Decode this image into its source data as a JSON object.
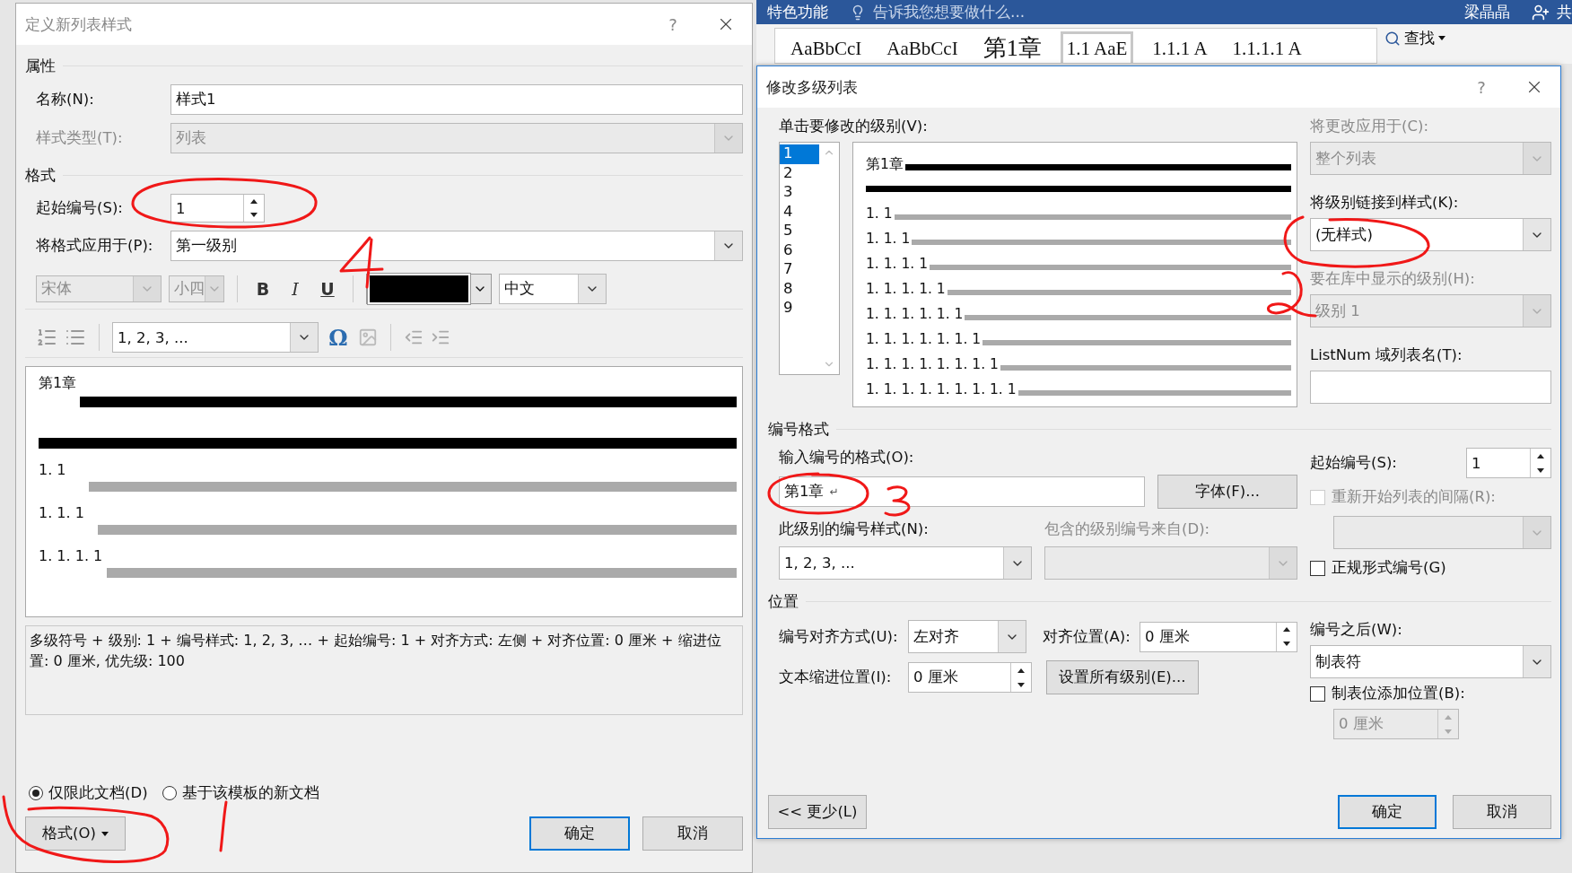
{
  "ribbon": {
    "feature_tab": "特色功能",
    "tell_me": "告诉我您想要做什么...",
    "user": "梁晶晶",
    "share": "共"
  },
  "styles_gallery": {
    "styles": [
      {
        "sample": "AaBbCcI",
        "selected": false
      },
      {
        "sample": "AaBbCcI",
        "selected": false
      },
      {
        "sample": "第1章",
        "selected": false
      },
      {
        "sample": "1.1  AaE",
        "selected": true
      },
      {
        "sample": "1.1.1  A",
        "selected": false
      },
      {
        "sample": "1.1.1.1  A",
        "selected": false
      }
    ],
    "find": "查找"
  },
  "define_list_style_dialog": {
    "title": "定义新列表样式",
    "help": "?",
    "properties_heading": "属性",
    "name": {
      "label": "名称(N):",
      "value": "样式1"
    },
    "style_type": {
      "label": "样式类型(T):",
      "value": "列表",
      "disabled": true
    },
    "format_heading": "格式",
    "start_at": {
      "label": "起始编号(S):",
      "value": "1"
    },
    "apply_to": {
      "label": "将格式应用于(P):",
      "value": "第一级别"
    },
    "font": {
      "value": "宋体",
      "disabled": true
    },
    "size": {
      "value": "小四",
      "disabled": true
    },
    "bold": "B",
    "italic": "I",
    "underline": "U",
    "language": {
      "value": "中文"
    },
    "number_style": {
      "value": "1, 2, 3, ..."
    },
    "symbol": "Ω",
    "preview": [
      {
        "number": "第1章",
        "selected": true
      },
      {
        "number": "1. 1",
        "selected": false
      },
      {
        "number": "1. 1. 1",
        "selected": false
      },
      {
        "number": "1. 1. 1. 1",
        "selected": false
      }
    ],
    "description": "多级符号 + 级别: 1 + 编号样式: 1, 2, 3, … + 起始编号: 1 + 对齐方式: 左侧 + 对齐位置:  0 厘米 + 缩进位置:  0 厘米, 优先级: 100",
    "scope": [
      {
        "label": "仅限此文档(D)",
        "selected": true
      },
      {
        "label": "基于该模板的新文档",
        "selected": false
      }
    ],
    "format_button": "格式(O)",
    "ok": "确定",
    "cancel": "取消"
  },
  "modify_multilevel_dialog": {
    "title": "修改多级列表",
    "help": "?",
    "level_label": "单击要修改的级别(V):",
    "levels": [
      {
        "label": "1",
        "selected": true
      },
      {
        "label": "2",
        "selected": false
      },
      {
        "label": "3",
        "selected": false
      },
      {
        "label": "4",
        "selected": false
      },
      {
        "label": "5",
        "selected": false
      },
      {
        "label": "6",
        "selected": false
      },
      {
        "label": "7",
        "selected": false
      },
      {
        "label": "8",
        "selected": false
      },
      {
        "label": "9",
        "selected": false
      }
    ],
    "preview": [
      {
        "number": "第1章",
        "selected": true
      },
      {
        "number": "1. 1",
        "selected": false
      },
      {
        "number": "1. 1. 1",
        "selected": false
      },
      {
        "number": "1. 1. 1. 1",
        "selected": false
      },
      {
        "number": "1. 1. 1. 1. 1",
        "selected": false
      },
      {
        "number": "1. 1. 1. 1. 1. 1",
        "selected": false
      },
      {
        "number": "1. 1. 1. 1. 1. 1. 1",
        "selected": false
      },
      {
        "number": "1. 1. 1. 1. 1. 1. 1. 1",
        "selected": false
      },
      {
        "number": "1. 1. 1. 1. 1. 1. 1. 1. 1",
        "selected": false
      }
    ],
    "apply_changes_to": {
      "label": "将更改应用于(C):",
      "value": "整个列表",
      "disabled": true
    },
    "link_style": {
      "label": "将级别链接到样式(K):",
      "value": "(无样式)",
      "disabled": false
    },
    "gallery_level": {
      "label": "要在库中显示的级别(H):",
      "value": "级别 1",
      "disabled": true
    },
    "listnum_name": {
      "label": "ListNum 域列表名(T):"
    },
    "number_format_heading": "编号格式",
    "format_input": {
      "label": "输入编号的格式(O):",
      "value": "第1章",
      "mark": "↵"
    },
    "font_button": "字体(F)...",
    "start_at": {
      "label": "起始编号(S):",
      "value": "1"
    },
    "restart": {
      "label": "重新开始列表的间隔(R):",
      "checked": false,
      "disabled": true
    },
    "restart_after": {
      "disabled": true
    },
    "legal_numbering": {
      "label": "正规形式编号(G)",
      "checked": false,
      "disabled": false
    },
    "number_style": {
      "label": "此级别的编号样式(N):",
      "value": "1, 2, 3, ...",
      "disabled": false
    },
    "include_from": {
      "label": "包含的级别编号来自(D):",
      "disabled": true
    },
    "position_heading": "位置",
    "alignment": {
      "label": "编号对齐方式(U):",
      "value": "左对齐",
      "disabled": false
    },
    "aligned_at": {
      "label": "对齐位置(A):",
      "value": "0 厘米"
    },
    "follow_with": {
      "label": "编号之后(W):",
      "value": "制表符",
      "disabled": false
    },
    "indent_at": {
      "label": "文本缩进位置(I):",
      "value": "0 厘米"
    },
    "set_all_button": "设置所有级别(E)...",
    "tab_stop": {
      "label": "制表位添加位置(B):",
      "checked": false,
      "disabled": false
    },
    "tab_stop_value": {
      "value": "0 厘米",
      "disabled": true
    },
    "less_button": "<< 更少(L)",
    "ok": "确定",
    "cancel": "取消"
  }
}
